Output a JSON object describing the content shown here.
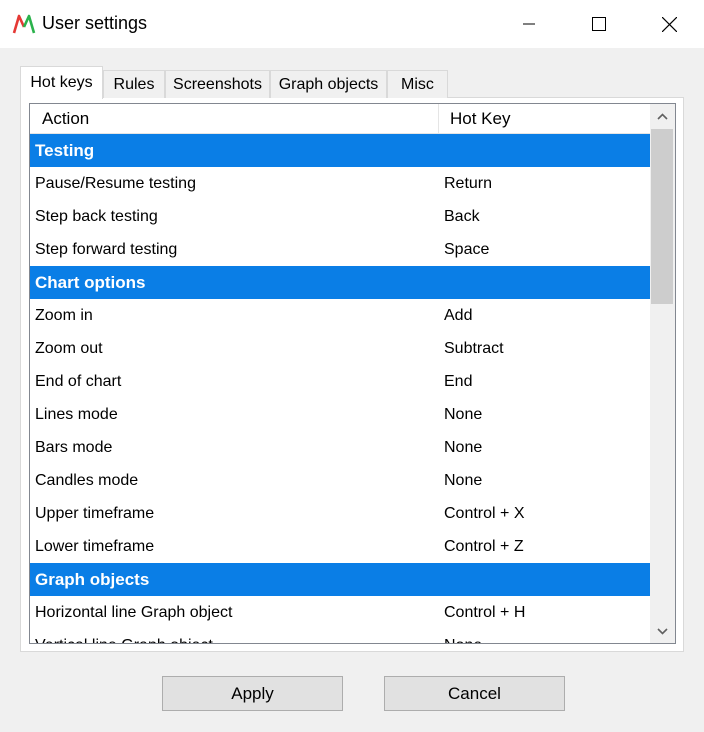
{
  "window": {
    "title": "User settings"
  },
  "tabs": [
    {
      "label": "Hot keys"
    },
    {
      "label": "Rules"
    },
    {
      "label": "Screenshots"
    },
    {
      "label": "Graph objects"
    },
    {
      "label": "Misc"
    }
  ],
  "table": {
    "columns": [
      "Action",
      "Hot Key"
    ],
    "rows": [
      {
        "type": "group",
        "action": "Testing",
        "key": ""
      },
      {
        "type": "item",
        "action": "Pause/Resume testing",
        "key": "Return"
      },
      {
        "type": "item",
        "action": "Step back testing",
        "key": "Back"
      },
      {
        "type": "item",
        "action": "Step forward testing",
        "key": "Space"
      },
      {
        "type": "group",
        "action": "Chart options",
        "key": ""
      },
      {
        "type": "item",
        "action": "Zoom in",
        "key": "Add"
      },
      {
        "type": "item",
        "action": "Zoom out",
        "key": "Subtract"
      },
      {
        "type": "item",
        "action": "End of chart",
        "key": "End"
      },
      {
        "type": "item",
        "action": "Lines mode",
        "key": "None"
      },
      {
        "type": "item",
        "action": "Bars mode",
        "key": "None"
      },
      {
        "type": "item",
        "action": "Candles mode",
        "key": "None"
      },
      {
        "type": "item",
        "action": "Upper timeframe",
        "key": "Control + X"
      },
      {
        "type": "item",
        "action": "Lower timeframe",
        "key": "Control + Z"
      },
      {
        "type": "group",
        "action": "Graph objects",
        "key": ""
      },
      {
        "type": "item",
        "action": "Horizontal line Graph object",
        "key": "Control + H"
      },
      {
        "type": "item",
        "action": "Vertical line Graph object",
        "key": "None"
      }
    ]
  },
  "buttons": {
    "apply": "Apply",
    "cancel": "Cancel"
  },
  "colors": {
    "group_row": "#0a7ee6",
    "app_icon_red": "#e53935",
    "app_icon_green": "#2bb24c"
  }
}
